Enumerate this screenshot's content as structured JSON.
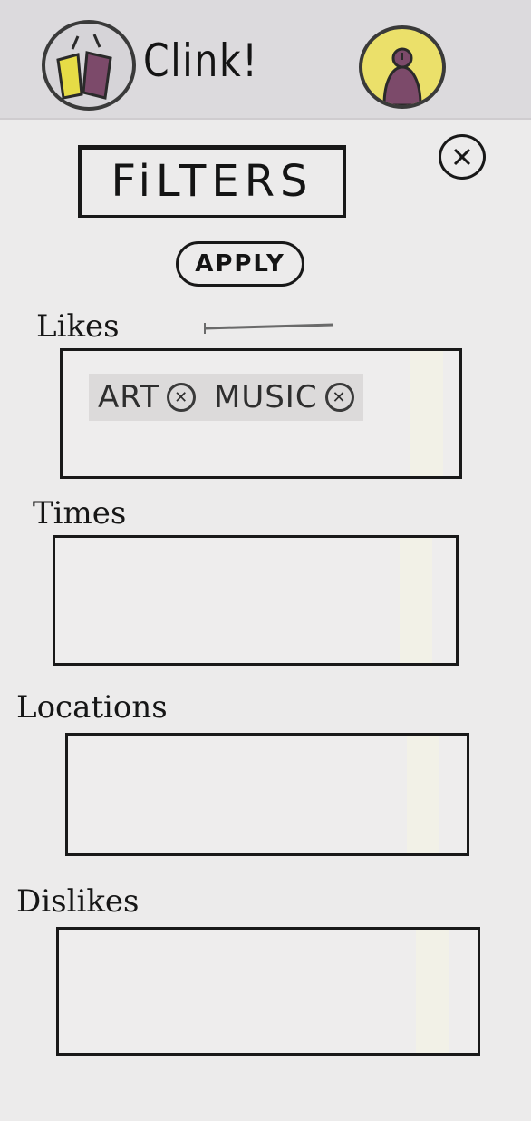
{
  "header": {
    "app_title": "Clink!",
    "logo_icon": "clinking-cups-icon",
    "avatar_icon": "user-avatar-icon"
  },
  "filters": {
    "title": "FiLTERS",
    "apply_label": "APPLY",
    "close_icon": "close-icon"
  },
  "sections": {
    "likes": {
      "label": "Likes",
      "chips": [
        {
          "label": "ART"
        },
        {
          "label": "MUSIC"
        }
      ]
    },
    "times": {
      "label": "Times"
    },
    "locations": {
      "label": "Locations"
    },
    "dislikes": {
      "label": "Dislikes"
    }
  },
  "colors": {
    "cup_yellow": "#e6dc46",
    "cup_purple": "#7c4a6a",
    "avatar_bg": "#ebe06a",
    "ink": "#181818"
  }
}
